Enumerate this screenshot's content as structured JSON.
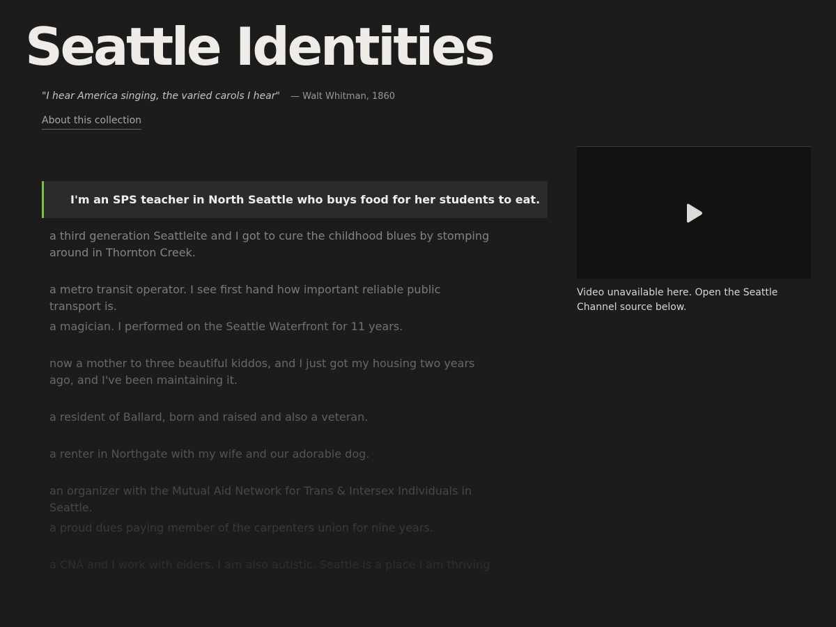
{
  "site": {
    "title": "Seattle Identities"
  },
  "epigraph": {
    "quote": "\"I hear America singing, the varied carols I hear\"",
    "attribution": "— Walt Whitman, 1860"
  },
  "nav": {
    "about_label": "About this collection"
  },
  "colors": {
    "background": "#1c1c1c",
    "featured_background": "#2b2b2b",
    "accent": "#7cc03f",
    "title": "#efebe6",
    "video_background": "#121212"
  },
  "featured_statement": "I'm an SPS teacher in North Seattle who buys food for her students to eat.",
  "statements": [
    "a third generation Seattleite and I got to cure the childhood blues by stomping around in Thornton Creek.",
    "a metro transit operator. I see first hand how important reliable public transport is.",
    "a magician. I performed on the Seattle Waterfront for 11 years.",
    "now a mother to three beautiful kiddos, and I just got my housing two years ago, and I've been maintaining it.",
    "a resident of Ballard, born and raised and also a veteran.",
    "a renter in Northgate with my wife and our adorable dog.",
    "an organizer with the Mutual Aid Network for Trans & Intersex Individuals in Seattle.",
    "a proud dues paying member of the carpenters union for nine years.",
    "a CNA and I work with elders. I am also autistic. Seattle is a place I am thriving"
  ],
  "video": {
    "play_icon": "play-icon",
    "note": "Video unavailable here. Open the Seattle Channel source below."
  }
}
